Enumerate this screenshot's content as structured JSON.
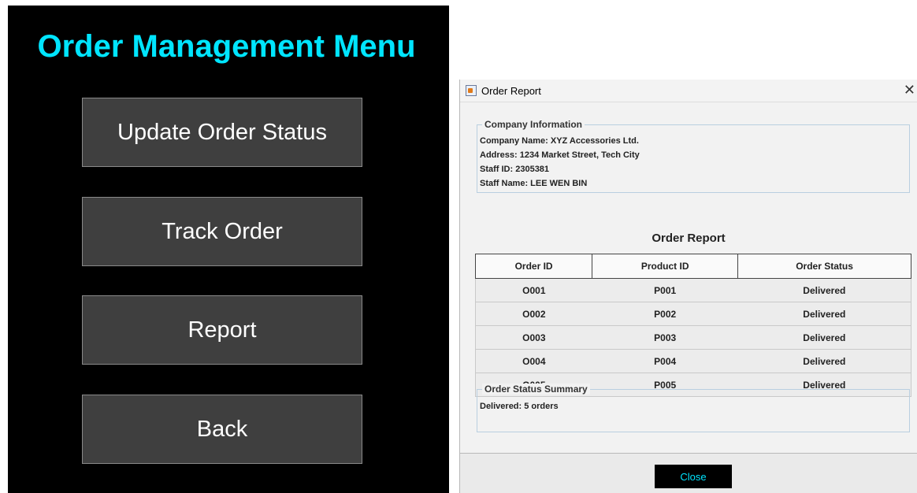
{
  "menu": {
    "title": "Order Management Menu",
    "buttons": [
      "Update Order Status",
      "Track Order",
      "Report",
      "Back"
    ]
  },
  "report_window": {
    "title": "Order Report",
    "company_info": {
      "legend": "Company Information",
      "lines": [
        "Company Name: XYZ Accessories Ltd.",
        "Address: 1234 Market Street, Tech City",
        "Staff ID: 2305381",
        "Staff Name: LEE WEN BIN"
      ]
    },
    "report_heading": "Order Report",
    "table": {
      "headers": [
        "Order ID",
        "Product ID",
        "Order Status"
      ],
      "rows": [
        [
          "O001",
          "P001",
          "Delivered"
        ],
        [
          "O002",
          "P002",
          "Delivered"
        ],
        [
          "O003",
          "P003",
          "Delivered"
        ],
        [
          "O004",
          "P004",
          "Delivered"
        ],
        [
          "O005",
          "P005",
          "Delivered"
        ]
      ]
    },
    "summary": {
      "legend": "Order Status Summary",
      "text": "Delivered: 5 orders"
    },
    "close_label": "Close"
  },
  "colors": {
    "accent": "#00e5ff",
    "menu_bg": "#000000",
    "button_bg": "#3f3f3f"
  }
}
